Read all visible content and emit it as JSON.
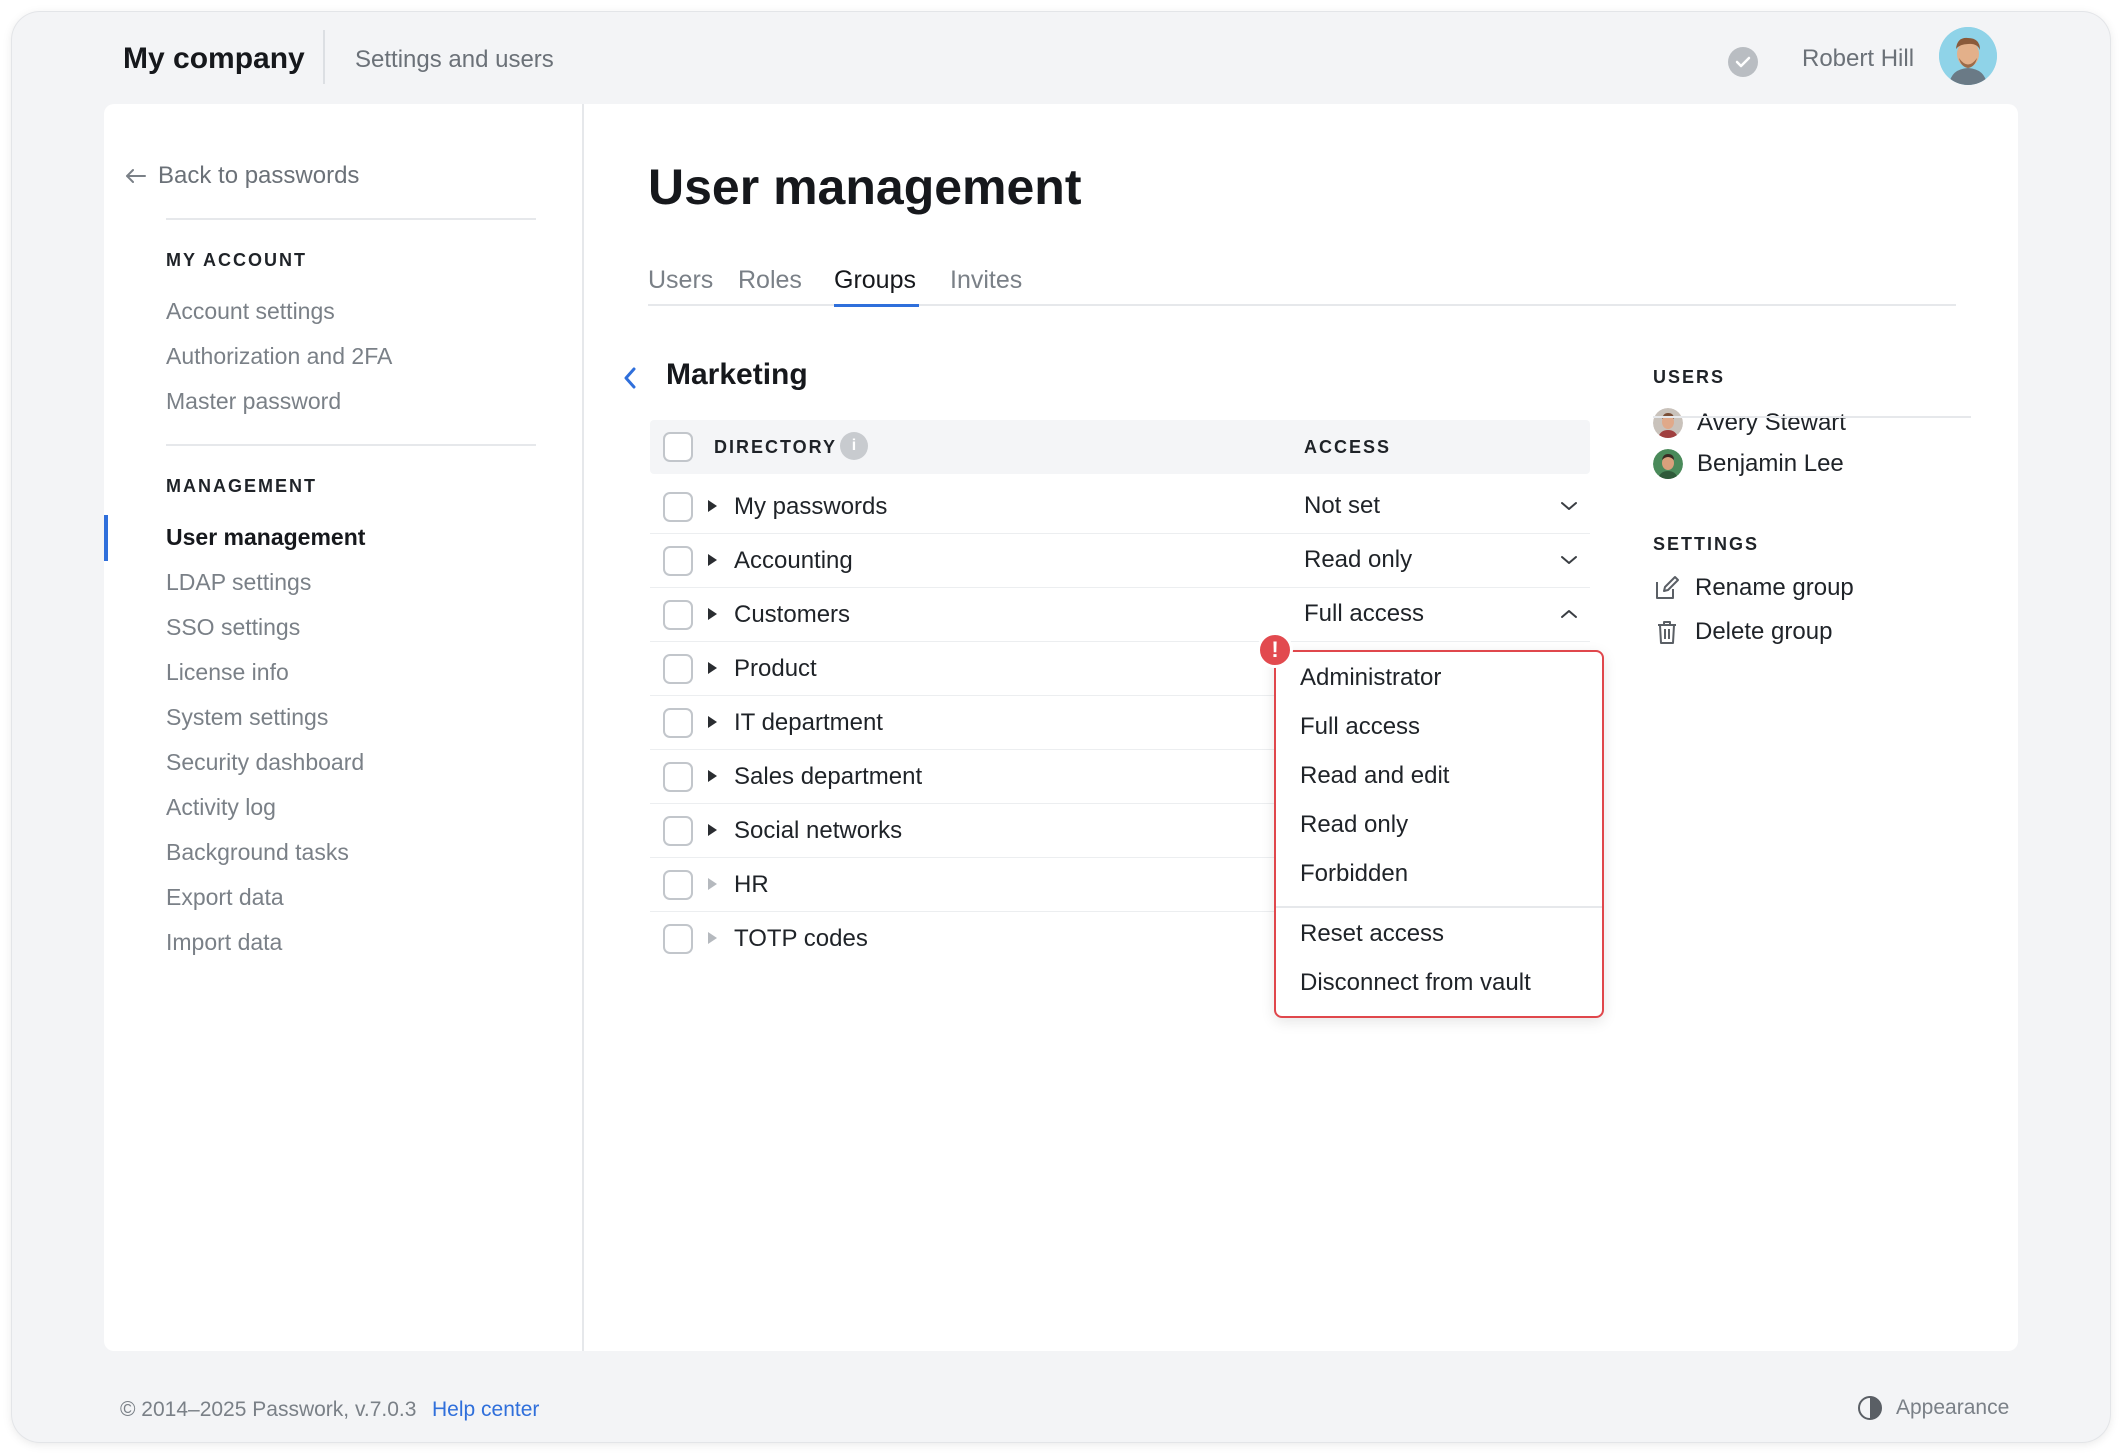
{
  "app": {
    "brand": "My company",
    "subtitle": "Settings and users",
    "user_name": "Robert Hill"
  },
  "sidebar": {
    "back_label": "Back to passwords",
    "my_account_heading": "MY ACCOUNT",
    "my_account_items": [
      "Account settings",
      "Authorization and 2FA",
      "Master password"
    ],
    "management_heading": "MANAGEMENT",
    "management_items": [
      "User management",
      "LDAP settings",
      "SSO settings",
      "License info",
      "System settings",
      "Security dashboard",
      "Activity log",
      "Background tasks",
      "Export data",
      "Import data"
    ],
    "active_item": "User management"
  },
  "main": {
    "title": "User management",
    "tabs": [
      "Users",
      "Roles",
      "Groups",
      "Invites"
    ],
    "active_tab": "Groups",
    "group_name": "Marketing",
    "table": {
      "col_directory": "DIRECTORY",
      "col_access": "ACCESS",
      "rows": [
        {
          "name": "My passwords",
          "access": "Not set",
          "expandable": true
        },
        {
          "name": "Accounting",
          "access": "Read only",
          "expandable": true
        },
        {
          "name": "Customers",
          "access": "Full access",
          "expandable": true,
          "dropdown_open": true
        },
        {
          "name": "Product",
          "access": "",
          "expandable": true
        },
        {
          "name": "IT department",
          "access": "",
          "expandable": true
        },
        {
          "name": "Sales department",
          "access": "",
          "expandable": true
        },
        {
          "name": "Social networks",
          "access": "",
          "expandable": true
        },
        {
          "name": "HR",
          "access": "",
          "expandable": false
        },
        {
          "name": "TOTP codes",
          "access": "",
          "expandable": false
        }
      ]
    },
    "access_dropdown": {
      "alert_icon": "!",
      "options": [
        "Administrator",
        "Full access",
        "Read and edit",
        "Read only",
        "Forbidden"
      ],
      "actions": [
        "Reset access",
        "Disconnect from vault"
      ]
    }
  },
  "right_panel": {
    "users_heading": "USERS",
    "users": [
      "Avery Stewart",
      "Benjamin Lee"
    ],
    "settings_heading": "SETTINGS",
    "actions": [
      "Rename group",
      "Delete group"
    ]
  },
  "footer": {
    "copyright": "© 2014–2025 Passwork, v.7.0.3",
    "help": "Help center",
    "appearance": "Appearance"
  },
  "colors": {
    "accent": "#2f6fdb",
    "alert": "#e24a4f",
    "muted_text": "#7a8087"
  },
  "icons": [
    "status-check-icon",
    "arrow-left-icon",
    "chevron-left-icon",
    "info-icon",
    "chevron-down-icon",
    "chevron-up-icon",
    "alert-icon",
    "edit-icon",
    "trash-icon",
    "appearance-icon"
  ]
}
